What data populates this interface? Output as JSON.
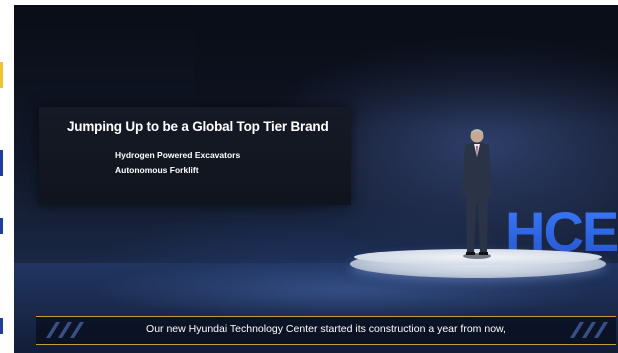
{
  "stage_screen": {
    "title": "Jumping Up to be a Global Top Tier Brand",
    "items": [
      "Hydrogen Powered Excavators",
      "Autonomous Forklift"
    ]
  },
  "backdrop_logo": {
    "text": "HCE"
  },
  "subtitle": {
    "text": "Our new Hyundai Technology Center started its construction a year from now,"
  },
  "colors": {
    "background": "#111829",
    "accent_gold": "#c99a3b",
    "logo_blue": "#2f6df0",
    "strip_yellow": "#f2c230",
    "strip_blue": "#1f3f9a"
  }
}
